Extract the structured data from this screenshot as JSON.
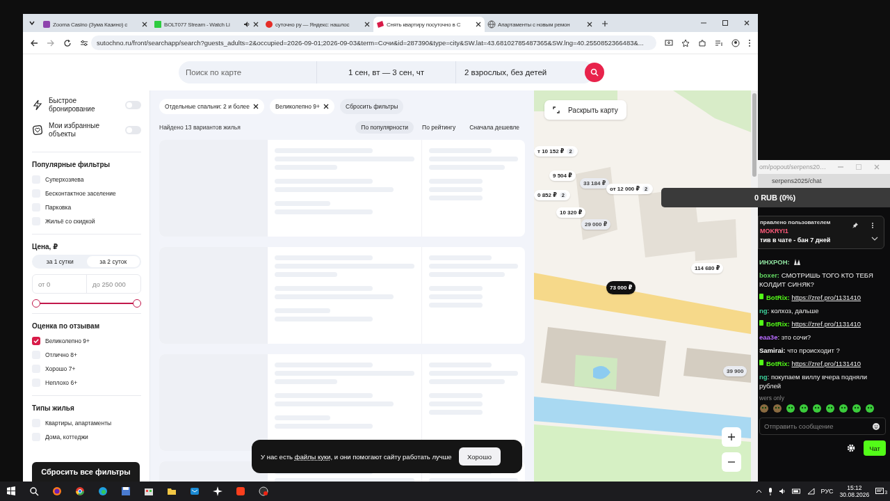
{
  "browser": {
    "tabs": [
      {
        "title": "Zooma Casino (Зума Казино) с",
        "selected": false,
        "audio": false,
        "kind": "square"
      },
      {
        "title": "BOLT077 Stream - Watch Li",
        "selected": false,
        "audio": true,
        "kind": "green"
      },
      {
        "title": "суточно ру — Яндекс: нашлос",
        "selected": false,
        "audio": false,
        "kind": "circle"
      },
      {
        "title": "Снять квартиру посуточно в С",
        "selected": true,
        "audio": false,
        "kind": "red"
      },
      {
        "title": "Апартаменты с новым ремон",
        "selected": false,
        "audio": false,
        "kind": "globe"
      }
    ],
    "address": "sutochno.ru/front/searchapp/search?guests_adults=2&occupied=2026-09-01;2026-09-03&term=Сочи&id=287390&type=city&SW.lat=43.68102785487365&SW.lng=40.2550852366483&..."
  },
  "search_bar": {
    "placeholder": "Поиск по карте",
    "dates": "1 сен, вт — 3 сен, чт",
    "guests": "2 взрослых, без детей"
  },
  "sidebar": {
    "toggles": [
      {
        "label": "Быстрое бронирование",
        "on": false,
        "kind": "bolt"
      },
      {
        "label": "Мои избранные объекты",
        "on": false,
        "kind": "heart"
      }
    ],
    "popular": {
      "title": "Популярные фильтры",
      "options": [
        {
          "label": "Суперхозяева",
          "checked": false
        },
        {
          "label": "Бесконтактное заселение",
          "checked": false
        },
        {
          "label": "Парковка",
          "checked": false
        },
        {
          "label": "Жильё со скидкой",
          "checked": false
        }
      ]
    },
    "price": {
      "title": "Цена, ₽",
      "periods": [
        {
          "label": "за 1 сутки",
          "selected": false
        },
        {
          "label": "за 2 суток",
          "selected": true
        }
      ],
      "from": "от 0",
      "to": "до 250 000",
      "low": {
        "level": 0
      },
      "high": {
        "level": 1
      }
    },
    "rating": {
      "title": "Оценка по отзывам",
      "options": [
        {
          "label": "Великолепно 9+",
          "checked": true
        },
        {
          "label": "Отлично 8+",
          "checked": false
        },
        {
          "label": "Хорошо 7+",
          "checked": false
        },
        {
          "label": "Неплохо 6+",
          "checked": false
        }
      ]
    },
    "types": {
      "title": "Типы жилья",
      "options": [
        {
          "label": "Квартиры, апартаменты",
          "checked": false
        },
        {
          "label": "Дома, коттеджи",
          "checked": false
        }
      ]
    },
    "reset_button": "Сбросить все фильтры"
  },
  "listing": {
    "chips": [
      {
        "label": "Отдельные спальни: 2 и более"
      },
      {
        "label": "Великолепно 9+"
      }
    ],
    "reset_chip": "Сбросить фильтры",
    "found": "Найдено 13 вариантов жилья",
    "sort": [
      {
        "label": "По популярности",
        "selected": true
      },
      {
        "label": "По рейтингу",
        "selected": false
      },
      {
        "label": "Сначала дешевле",
        "selected": false
      }
    ],
    "placeholders": [
      {
        "kind": "skeleton"
      },
      {
        "kind": "skeleton"
      },
      {
        "kind": "skeleton"
      },
      {
        "kind": "skeleton"
      }
    ]
  },
  "map": {
    "expand_button": "Раскрыть карту",
    "pins": [
      {
        "price": "т 10 152 ₽",
        "count": "2",
        "selected": false,
        "viewed": false
      },
      {
        "price": "9 504 ₽",
        "selected": false,
        "viewed": false
      },
      {
        "price": "33 184 ₽",
        "selected": false,
        "viewed": true
      },
      {
        "price": "от 12 000 ₽",
        "count": "2",
        "selected": false,
        "viewed": false
      },
      {
        "price": "0 852 ₽",
        "count": "2",
        "selected": false,
        "viewed": false
      },
      {
        "price": "10 320 ₽",
        "selected": false,
        "viewed": false
      },
      {
        "price": "29 000 ₽",
        "selected": false,
        "viewed": true
      },
      {
        "price": "114 680 ₽",
        "selected": false,
        "viewed": false
      },
      {
        "price": "73 000 ₽",
        "selected": true,
        "viewed": false
      },
      {
        "price": "39 900",
        "selected": false,
        "viewed": true
      }
    ]
  },
  "cookie": {
    "before": "У нас есть ",
    "link": "файлы куки",
    "after": ", и они помогают сайту работать лучше",
    "button": "Хорошо"
  },
  "chat": {
    "title": "om/popout/serpens20…",
    "url": "serpens2025/chat",
    "donation": "0 RUB (0%)",
    "pinned": {
      "label": "правлено пользователем",
      "user": "MOKRYI1",
      "text": "тив в чате - бан 7 дней"
    },
    "messages": [
      {
        "user": "ИНХРОН:",
        "color": "#8fe3a0",
        "kind": "emote"
      },
      {
        "user": "boxer:",
        "color": "#5fd35f",
        "text": " СМОТРИШЬ ТОГО КТО ТЕБЯ КОЛДИТ СИНЯК?",
        "kind": "text"
      },
      {
        "user": "BotRix:",
        "color": "#53fc18",
        "link": "https://zref.pro/1131410",
        "kind": "bot"
      },
      {
        "user": "ng",
        "color": "#3ccf9a",
        "text": ": колхоз, дальше",
        "kind": "text"
      },
      {
        "user": "BotRix:",
        "color": "#53fc18",
        "link": "https://zref.pro/1131410",
        "kind": "bot"
      },
      {
        "user": "eaa3e",
        "color": "#b86bff",
        "text": ": это сочи?",
        "kind": "text"
      },
      {
        "user": "Samirai:",
        "color": "#ffffff",
        "text": " что происходит ?",
        "kind": "text"
      },
      {
        "user": "BotRix:",
        "color": "#53fc18",
        "link": "https://zref.pro/1131410",
        "kind": "bot"
      },
      {
        "user": "ng",
        "color": "#3ccf9a",
        "text": ": покупаем виллу вчера подняли рублей",
        "kind": "text"
      }
    ],
    "mode": "wers only",
    "input_placeholder": "Отправить сообщение",
    "send_button": "Чат"
  },
  "taskbar": {
    "language": "РУС",
    "time": "15:12",
    "date": "30.08.2026",
    "notifications": "3"
  }
}
